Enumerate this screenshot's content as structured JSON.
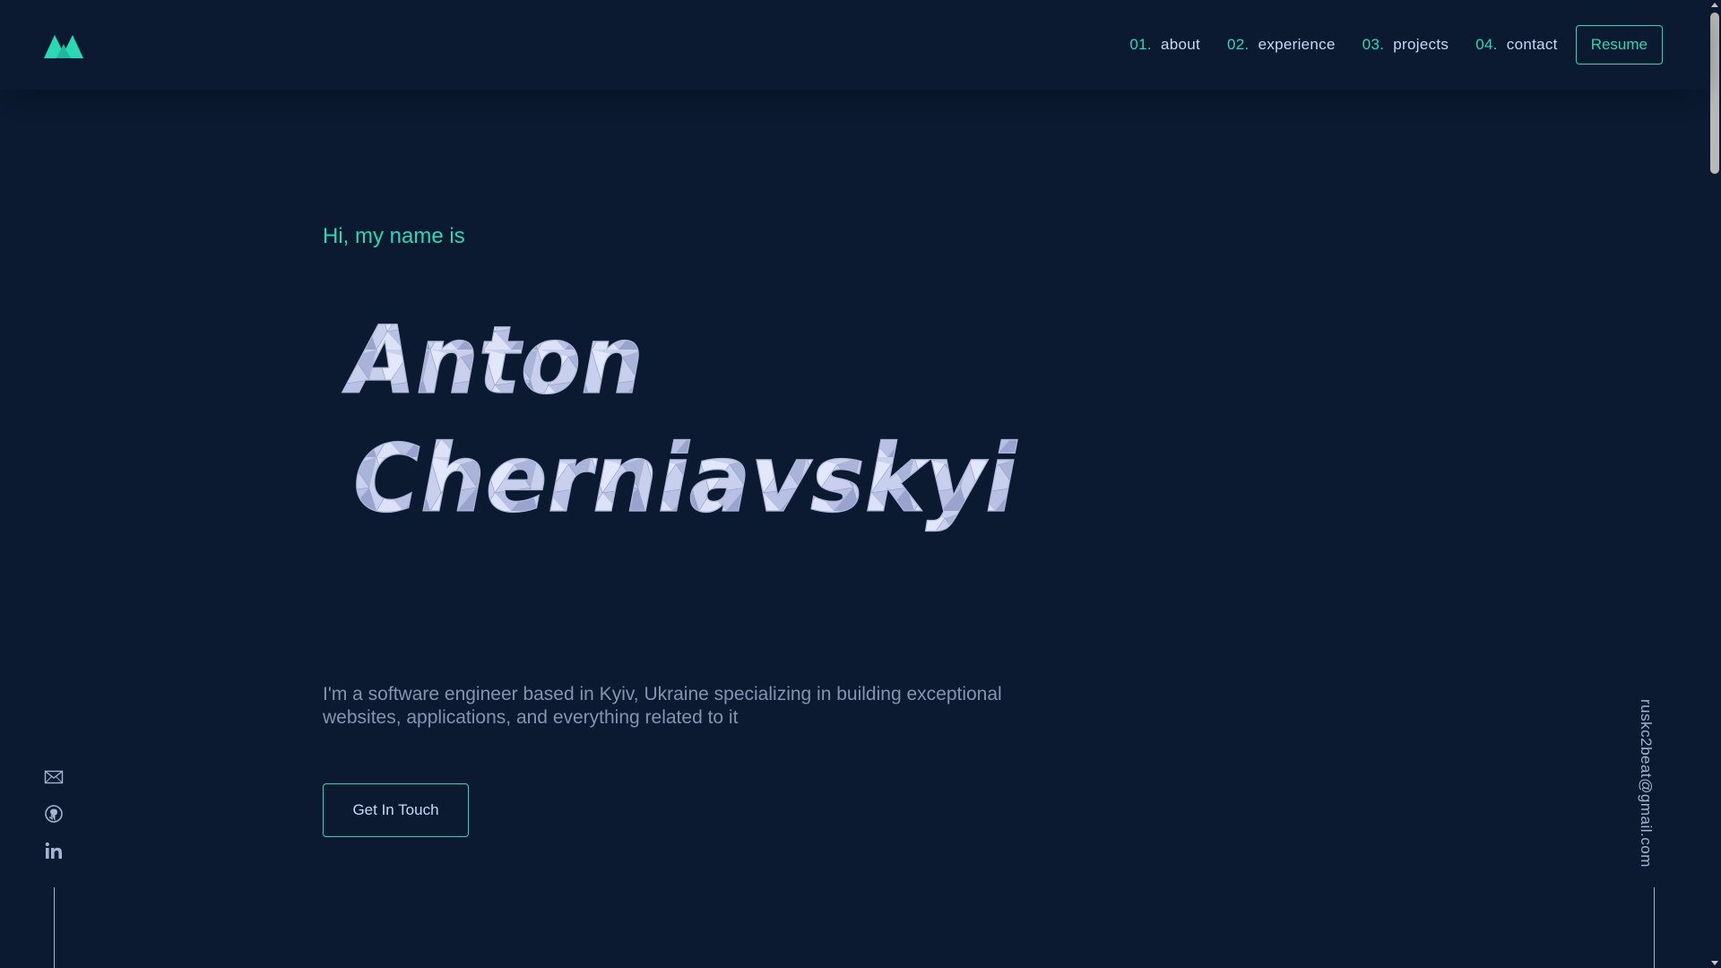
{
  "colors": {
    "background": "#0b1a30",
    "accent": "#2ad8b7",
    "heading": "#ccd6f6",
    "text": "#8892b0",
    "muted": "#a8b2d1"
  },
  "header": {
    "logo_icon": "mountain-logo-icon",
    "nav": [
      {
        "number": "01.",
        "label": "about"
      },
      {
        "number": "02.",
        "label": "experience"
      },
      {
        "number": "03.",
        "label": "projects"
      },
      {
        "number": "04.",
        "label": "contact"
      }
    ],
    "resume_label": "Resume"
  },
  "hero": {
    "greeting": "Hi, my name is",
    "first_name": "Anton",
    "last_name": "Cherniavskyi",
    "bio": "I'm a software engineer based in Kyiv, Ukraine specializing in building exceptional websites, applications, and everything related to it",
    "cta_label": "Get In Touch"
  },
  "social": [
    {
      "icon": "mail-icon"
    },
    {
      "icon": "github-icon"
    },
    {
      "icon": "linkedin-icon"
    }
  ],
  "email": "ruskc2beat@gmail.com"
}
